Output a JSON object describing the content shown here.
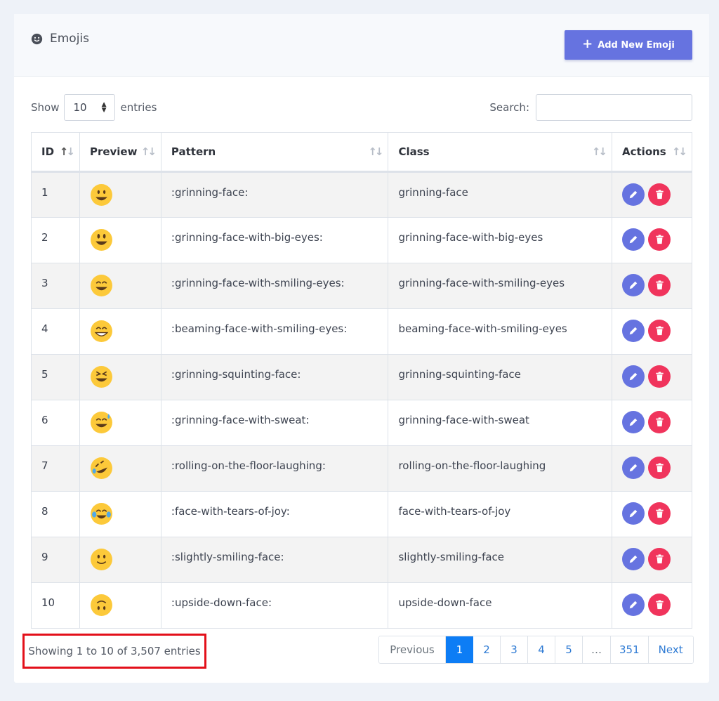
{
  "header": {
    "title": "Emojis",
    "add_button_label": "Add New Emoji",
    "accent": "#6673e0"
  },
  "controls": {
    "show_label": "Show",
    "page_length": "10",
    "entries_label": "entries",
    "search_label": "Search:",
    "search_value": ""
  },
  "table": {
    "columns": [
      "ID",
      "Preview",
      "Pattern",
      "Class",
      "Actions"
    ],
    "rows": [
      {
        "id": "1",
        "emoji": "grinning-face",
        "pattern": ":grinning-face:",
        "class": "grinning-face"
      },
      {
        "id": "2",
        "emoji": "grinning-face-with-big-eyes",
        "pattern": ":grinning-face-with-big-eyes:",
        "class": "grinning-face-with-big-eyes"
      },
      {
        "id": "3",
        "emoji": "grinning-face-with-smiling-eyes",
        "pattern": ":grinning-face-with-smiling-eyes:",
        "class": "grinning-face-with-smiling-eyes"
      },
      {
        "id": "4",
        "emoji": "beaming-face-with-smiling-eyes",
        "pattern": ":beaming-face-with-smiling-eyes:",
        "class": "beaming-face-with-smiling-eyes"
      },
      {
        "id": "5",
        "emoji": "grinning-squinting-face",
        "pattern": ":grinning-squinting-face:",
        "class": "grinning-squinting-face"
      },
      {
        "id": "6",
        "emoji": "grinning-face-with-sweat",
        "pattern": ":grinning-face-with-sweat:",
        "class": "grinning-face-with-sweat"
      },
      {
        "id": "7",
        "emoji": "rolling-on-the-floor-laughing",
        "pattern": ":rolling-on-the-floor-laughing:",
        "class": "rolling-on-the-floor-laughing"
      },
      {
        "id": "8",
        "emoji": "face-with-tears-of-joy",
        "pattern": ":face-with-tears-of-joy:",
        "class": "face-with-tears-of-joy"
      },
      {
        "id": "9",
        "emoji": "slightly-smiling-face",
        "pattern": ":slightly-smiling-face:",
        "class": "slightly-smiling-face"
      },
      {
        "id": "10",
        "emoji": "upside-down-face",
        "pattern": ":upside-down-face:",
        "class": "upside-down-face"
      }
    ]
  },
  "footer": {
    "info": "Showing 1 to 10 of 3,507 entries",
    "pagination": [
      "Previous",
      "1",
      "2",
      "3",
      "4",
      "5",
      "…",
      "351",
      "Next"
    ],
    "active_page": "1"
  },
  "colors": {
    "edit": "#6673e0",
    "delete": "#f0345c",
    "active_page": "#0d7df5",
    "highlight_border": "#e3101a"
  }
}
